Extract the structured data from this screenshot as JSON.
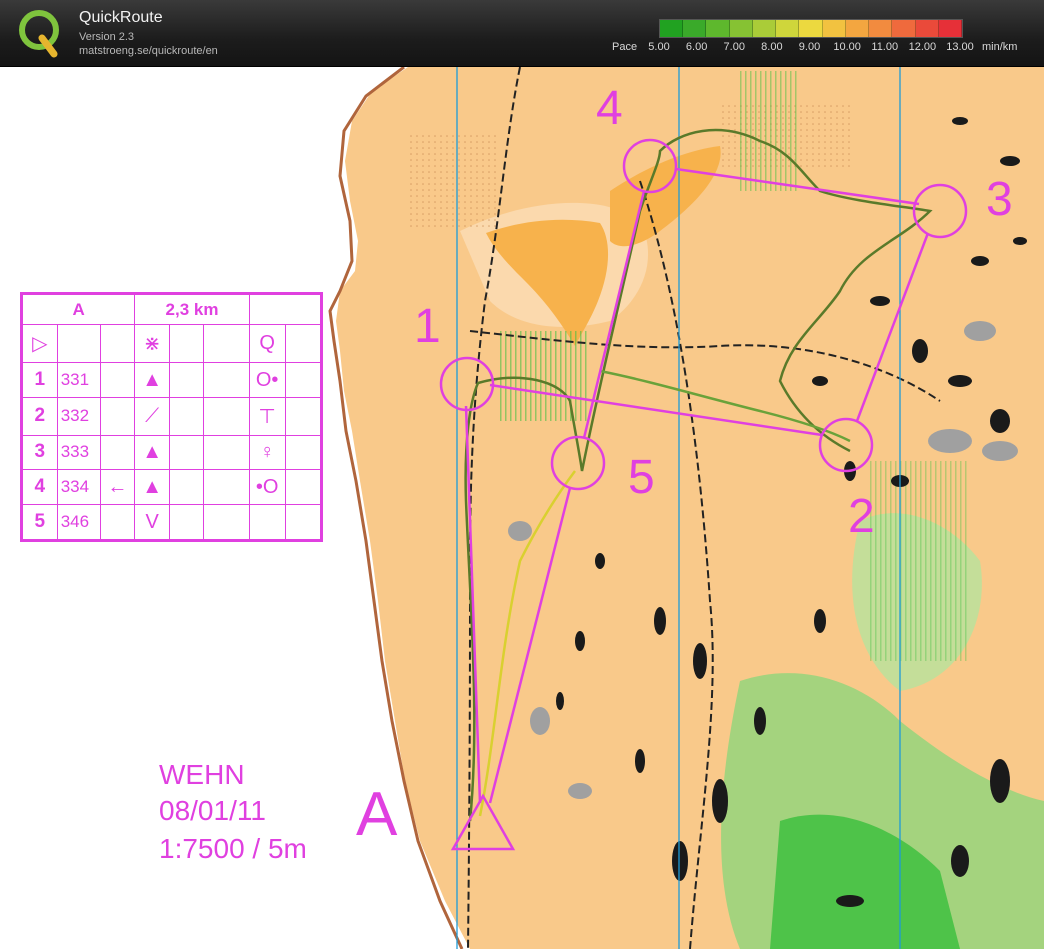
{
  "app": {
    "name": "QuickRoute",
    "version": "Version 2.3",
    "url": "matstroeng.se/quickroute/en"
  },
  "pace": {
    "label": "Pace",
    "ticks": [
      "5.00",
      "6.00",
      "7.00",
      "8.00",
      "9.00",
      "10.00",
      "11.00",
      "12.00",
      "13.00"
    ],
    "unit": "min/km",
    "colors": [
      "#21a221",
      "#3aaa2a",
      "#5eb82d",
      "#86c233",
      "#aacc38",
      "#cfd63b",
      "#ecd93f",
      "#f2c240",
      "#f3a640",
      "#f28b3f",
      "#ef6a3d",
      "#ea4a3a",
      "#e63038"
    ]
  },
  "course": {
    "name": "A",
    "length": "2,3 km",
    "controls": [
      {
        "number": "1",
        "code": "331",
        "direction": "",
        "feature": "▲",
        "detail": "O•"
      },
      {
        "number": "2",
        "code": "332",
        "direction": "",
        "feature": "⟋",
        "detail": "⊤"
      },
      {
        "number": "3",
        "code": "333",
        "direction": "",
        "feature": "▲",
        "detail": "♀"
      },
      {
        "number": "4",
        "code": "334",
        "direction": "←",
        "feature": "▲",
        "detail": "•O"
      },
      {
        "number": "5",
        "code": "346",
        "direction": "",
        "feature": "V",
        "detail": ""
      }
    ],
    "start_symbol": "▷",
    "start_feature": "⋇",
    "start_detail": "Q"
  },
  "event": {
    "club": "WEHN",
    "date": "08/01/11",
    "scale": "1:7500 / 5m"
  },
  "map_labels": {
    "start": "A",
    "c1": "1",
    "c2": "2",
    "c3": "3",
    "c4": "4",
    "c5": "5"
  },
  "colors": {
    "overprint": "#e040e0",
    "terrain": "#f9c98a",
    "forest_green": "#3fbf3f",
    "north_lines": "#1e9bd7"
  }
}
